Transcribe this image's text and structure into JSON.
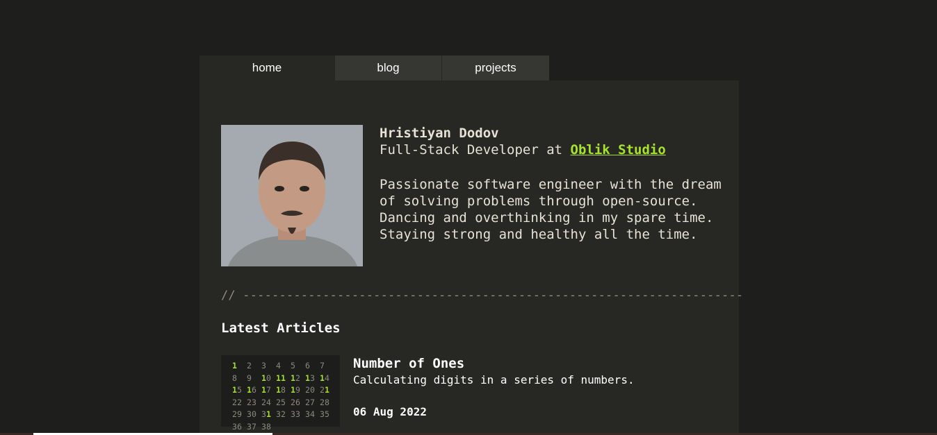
{
  "nav": {
    "tabs": [
      {
        "label": "home",
        "active": true
      },
      {
        "label": "blog",
        "active": false
      },
      {
        "label": "projects",
        "active": false
      }
    ]
  },
  "profile": {
    "name": "Hristiyan Dodov",
    "role_prefix": "Full-Stack Developer at ",
    "company": "Oblik Studio",
    "bio": "Passionate software engineer with the dream of solving problems through open-source. Dancing and overthinking in my spare time. Staying strong and healthy all the time."
  },
  "divider": "// ---------------------------------------------------------------------",
  "latest": {
    "heading": "Latest Articles",
    "articles": [
      {
        "title": "Number of Ones",
        "description": "Calculating digits in a series of numbers.",
        "date": "06 Aug 2022",
        "thumbnail_numbers": [
          "1",
          "2",
          "3",
          "4",
          "5",
          "6",
          "7",
          "8",
          "9",
          "10",
          "11",
          "12",
          "13",
          "14",
          "15",
          "16",
          "17",
          "18",
          "19",
          "20",
          "21",
          "22",
          "23",
          "24",
          "25",
          "26",
          "27",
          "28",
          "29",
          "30",
          "31",
          "32",
          "33",
          "34",
          "35",
          "36",
          "37",
          "38"
        ]
      }
    ]
  },
  "colors": {
    "accent": "#a6e22e",
    "background": "#1e1e1d",
    "panel": "#272723"
  }
}
